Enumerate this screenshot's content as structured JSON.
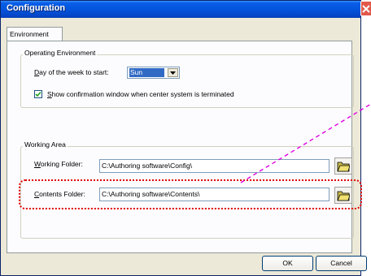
{
  "window": {
    "title": "Configuration"
  },
  "tabs": [
    {
      "label": "Environment"
    }
  ],
  "operating_environment": {
    "group_label": "Operating Environment",
    "day_label": "Day of the week to start:",
    "day_value": "Sun",
    "checkbox_label": "Show confirmation window when center system is terminated",
    "checkbox_checked": true
  },
  "working_area": {
    "group_label": "Working Area",
    "working_folder_label": "Working Folder:",
    "working_folder_value": "C:\\Authoring software\\Config\\",
    "contents_folder_label": "Contents Folder:",
    "contents_folder_value": "C:\\Authoring software\\Contents\\"
  },
  "buttons": {
    "ok": "OK",
    "cancel": "Cancel"
  },
  "icons": {
    "close": "close-icon",
    "folder": "folder-icon",
    "dropdown": "chevron-down-icon",
    "check": "check-icon"
  },
  "colors": {
    "titlebar": "#0454dc",
    "highlight": "#e00000",
    "annotation": "#e000e0"
  }
}
